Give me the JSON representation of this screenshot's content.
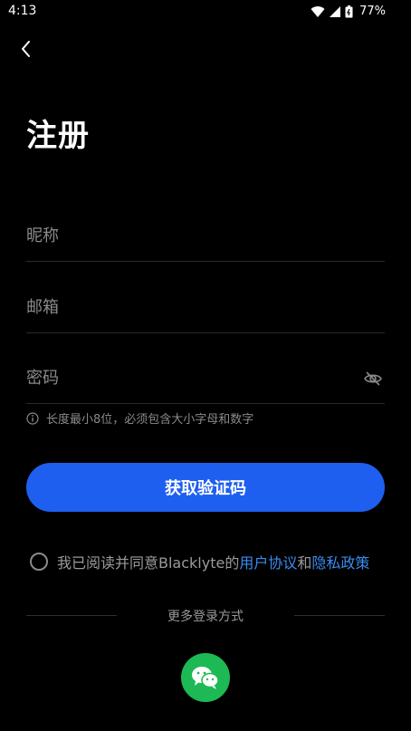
{
  "status_bar": {
    "time": "4:13",
    "battery": "77%"
  },
  "header": {
    "title": "注册"
  },
  "form": {
    "nickname_placeholder": "昵称",
    "email_placeholder": "邮箱",
    "password_placeholder": "密码",
    "password_hint": "长度最小8位，必须包含大小字母和数字"
  },
  "actions": {
    "get_code_label": "获取验证码"
  },
  "agreement": {
    "prefix": "我已阅读并同意Blacklyte的",
    "user_agreement": "用户协议",
    "and": "和",
    "privacy_policy": "隐私政策"
  },
  "more_login": {
    "label": "更多登录方式"
  },
  "colors": {
    "accent": "#1f5ff0",
    "link": "#3a8cf0",
    "wechat": "#1db954"
  },
  "icons": [
    "back-chevron-icon",
    "eye-off-icon",
    "info-icon",
    "wechat-icon",
    "wifi-icon",
    "signal-icon",
    "battery-icon"
  ]
}
